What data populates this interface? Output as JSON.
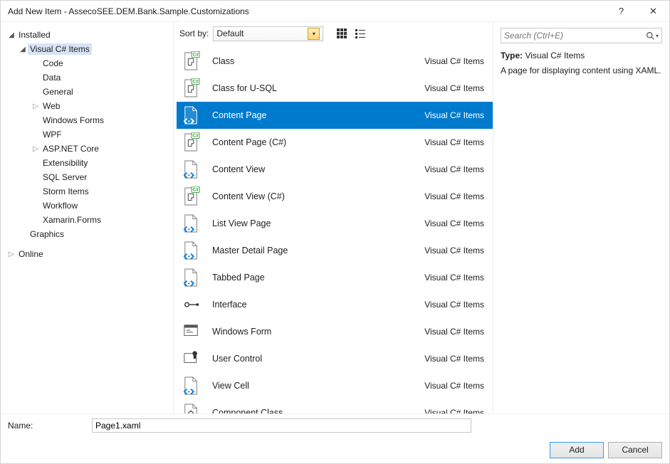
{
  "window": {
    "title": "Add New Item - AssecoSEE.DEM.Bank.Sample.Customizations",
    "help_tip": "?",
    "close_tip": "✕"
  },
  "left": {
    "installed": "Installed",
    "online": "Online",
    "items_root": "Visual C# Items",
    "children": [
      {
        "label": "Code",
        "exp": null
      },
      {
        "label": "Data",
        "exp": null
      },
      {
        "label": "General",
        "exp": null
      },
      {
        "label": "Web",
        "exp": "▷"
      },
      {
        "label": "Windows Forms",
        "exp": null
      },
      {
        "label": "WPF",
        "exp": null
      },
      {
        "label": "ASP.NET Core",
        "exp": "▷"
      },
      {
        "label": "Extensibility",
        "exp": null
      },
      {
        "label": "SQL Server",
        "exp": null
      },
      {
        "label": "Storm Items",
        "exp": null
      },
      {
        "label": "Workflow",
        "exp": null
      },
      {
        "label": "Xamarin.Forms",
        "exp": null
      }
    ],
    "graphics": "Graphics"
  },
  "center": {
    "sort_label": "Sort by:",
    "sort_value": "Default",
    "templates": [
      {
        "name": "Class",
        "cat": "Visual C# Items",
        "icon": "cs-class"
      },
      {
        "name": "Class for U-SQL",
        "cat": "Visual C# Items",
        "icon": "cs-class"
      },
      {
        "name": "Content Page",
        "cat": "Visual C# Items",
        "icon": "xaml-doc",
        "selected": true
      },
      {
        "name": "Content Page (C#)",
        "cat": "Visual C# Items",
        "icon": "cs-class"
      },
      {
        "name": "Content View",
        "cat": "Visual C# Items",
        "icon": "xaml-doc"
      },
      {
        "name": "Content View (C#)",
        "cat": "Visual C# Items",
        "icon": "cs-class"
      },
      {
        "name": "List View Page",
        "cat": "Visual C# Items",
        "icon": "xaml-doc"
      },
      {
        "name": "Master Detail Page",
        "cat": "Visual C# Items",
        "icon": "xaml-doc"
      },
      {
        "name": "Tabbed Page",
        "cat": "Visual C# Items",
        "icon": "xaml-doc"
      },
      {
        "name": "Interface",
        "cat": "Visual C# Items",
        "icon": "interface"
      },
      {
        "name": "Windows Form",
        "cat": "Visual C# Items",
        "icon": "winform"
      },
      {
        "name": "User Control",
        "cat": "Visual C# Items",
        "icon": "usercontrol"
      },
      {
        "name": "View Cell",
        "cat": "Visual C# Items",
        "icon": "xaml-doc"
      },
      {
        "name": "Component Class",
        "cat": "Visual C# Items",
        "icon": "component"
      }
    ]
  },
  "right": {
    "search_placeholder": "Search (Ctrl+E)",
    "type_label": "Type:",
    "type_value": "Visual C# Items",
    "description": "A page for displaying content using XAML."
  },
  "bottom": {
    "name_label": "Name:",
    "name_value": "Page1.xaml",
    "add": "Add",
    "cancel": "Cancel"
  }
}
